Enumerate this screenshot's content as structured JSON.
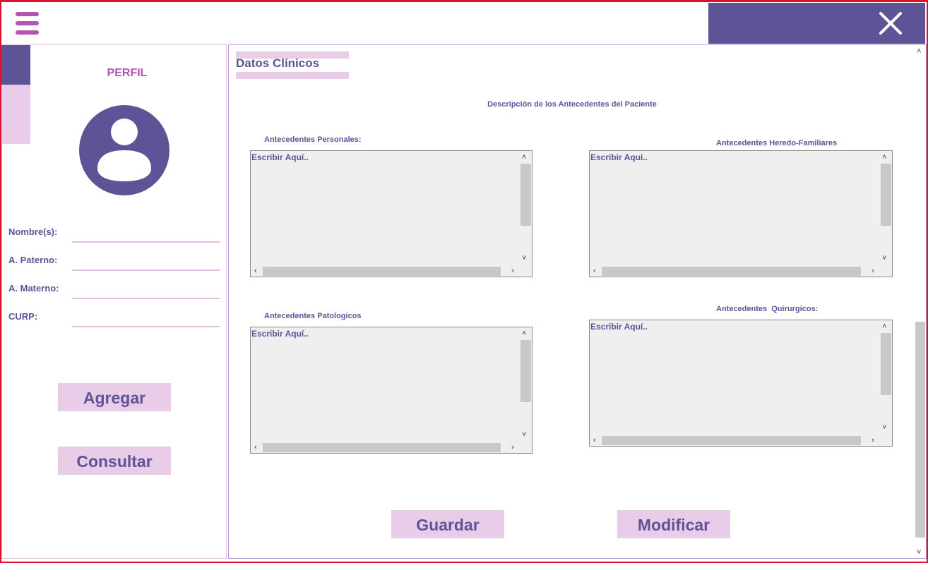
{
  "header": {
    "menu_icon": "hamburger-icon",
    "close_icon": "close-icon"
  },
  "sidebar": {
    "profile_title": "PERFIL",
    "avatar_icon": "user-avatar-icon",
    "fields": [
      {
        "label": "Nombre(s):",
        "value": ""
      },
      {
        "label": "A. Paterno:",
        "value": ""
      },
      {
        "label": "A. Materno:",
        "value": ""
      },
      {
        "label": "CURP:",
        "value": ""
      }
    ],
    "add_label": "Agregar",
    "consult_label": "Consultar"
  },
  "main": {
    "title": "Datos Clínicos",
    "subtitle": "Descripción de los Antecedentes del Paciente",
    "areas": {
      "personales": {
        "label": "Antecedentes Personales:",
        "value": "Escribir Aquí.."
      },
      "heredo": {
        "label": "Antecedentes Heredo-Familiares",
        "value": "Escribir Aquí.."
      },
      "patologicos": {
        "label": "Antecedentes Patologicos",
        "value": "Escribir Aquí.."
      },
      "quirurgicos": {
        "label": "Antecedentes  Quirurgicos:",
        "value": "Escribir Aquí.."
      }
    },
    "save_label": "Guardar",
    "modify_label": "Modificar"
  },
  "colors": {
    "accent": "#5f5398",
    "pink": "#b454b4",
    "light": "#e8cce8",
    "frame": "#e0102e"
  }
}
